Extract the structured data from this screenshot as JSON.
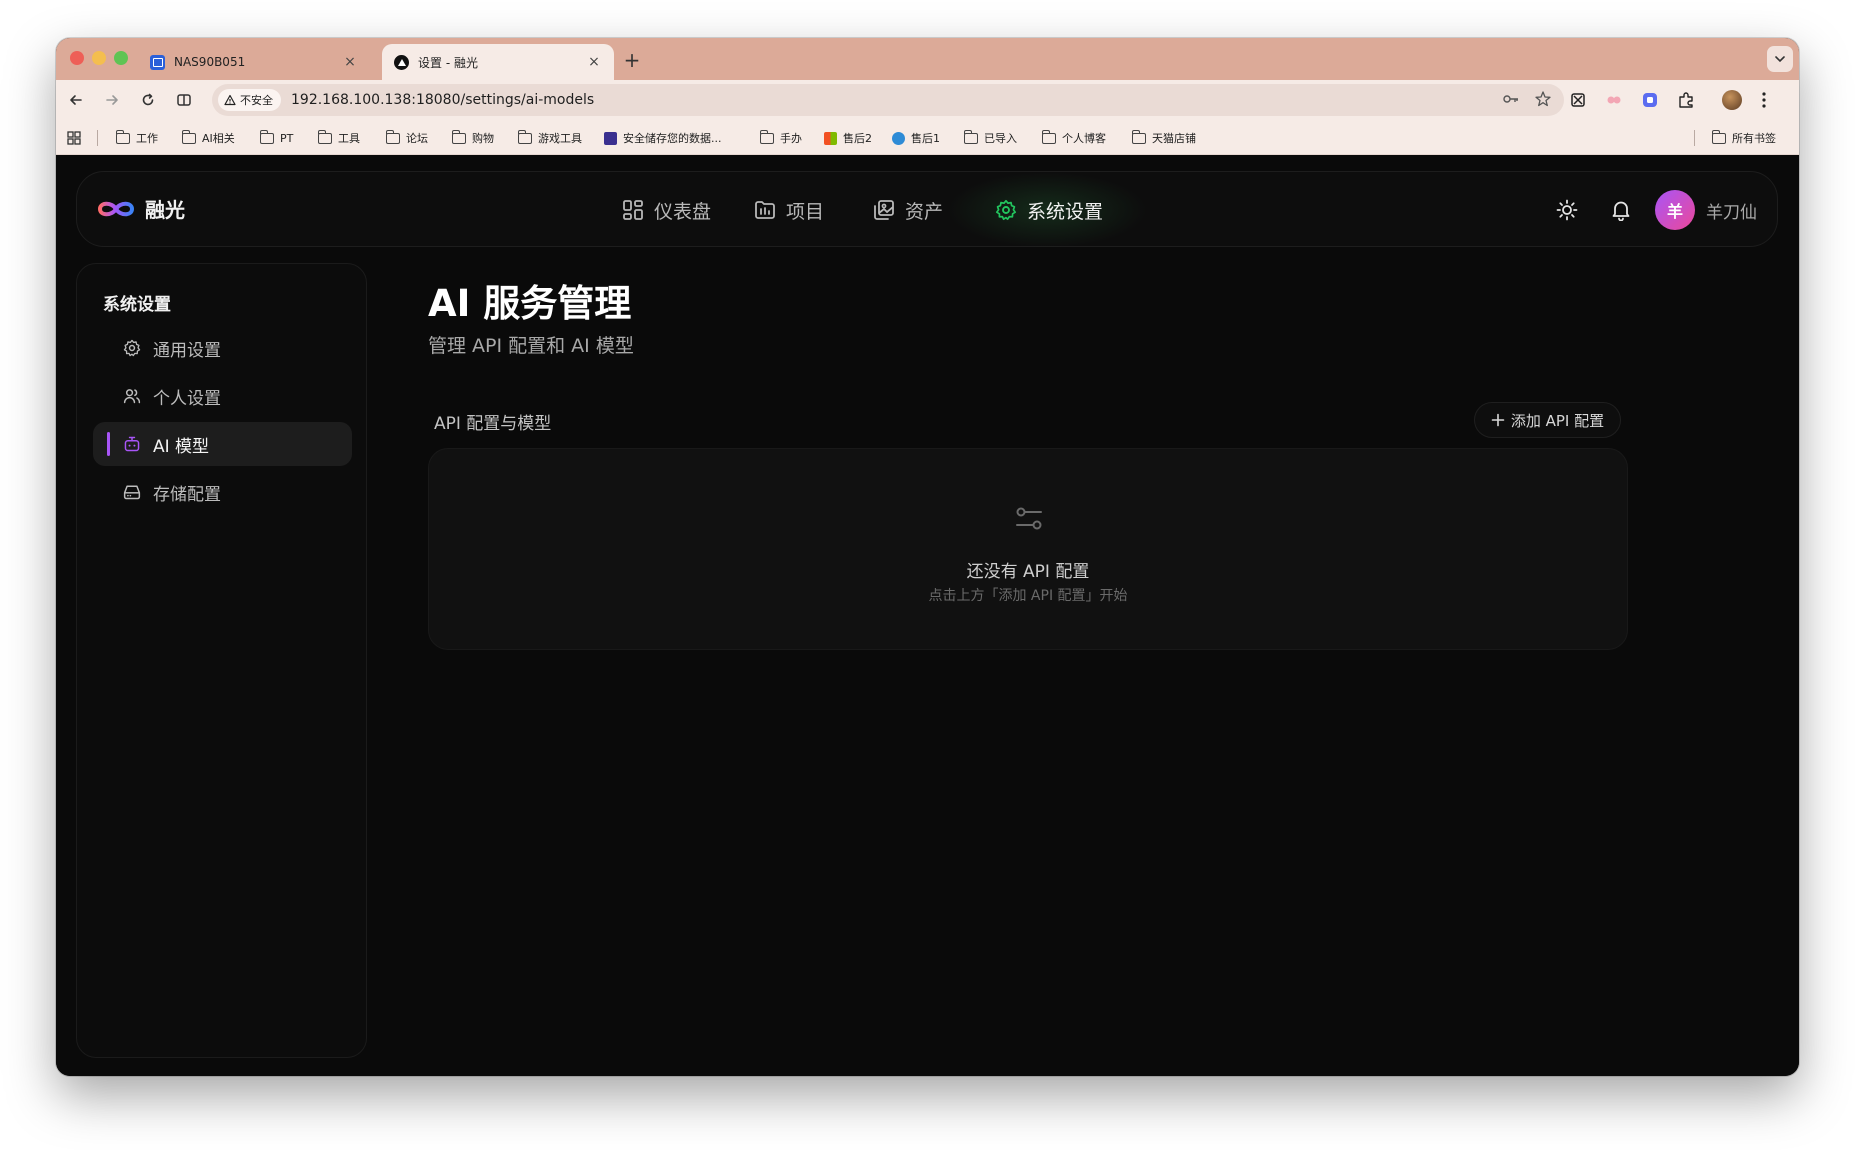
{
  "browser": {
    "tabs": [
      {
        "title": "NAS90B051",
        "close": "×"
      },
      {
        "title": "设置 - 融光",
        "close": "×"
      }
    ],
    "new_tab": "+",
    "security_label": "不安全",
    "url": "192.168.100.138:18080/settings/ai-models",
    "bookmarks": [
      "工作",
      "AI相关",
      "PT",
      "工具",
      "论坛",
      "购物",
      "游戏工具",
      "安全储存您的数据...",
      "手办",
      "售后2",
      "售后1",
      "已导入",
      "个人博客",
      "天猫店铺"
    ],
    "all_bookmarks": "所有书签"
  },
  "app": {
    "logo_text": "融光",
    "nav": [
      {
        "label": "仪表盘",
        "icon": "dashboard-icon"
      },
      {
        "label": "项目",
        "icon": "folder-icon"
      },
      {
        "label": "资产",
        "icon": "images-icon"
      },
      {
        "label": "系统设置",
        "icon": "gear-icon",
        "active": true
      }
    ],
    "user": {
      "avatar_letter": "羊",
      "name": "羊刀仙"
    },
    "accent_color": "#a855f7",
    "active_nav_color": "#22c55e"
  },
  "sidebar": {
    "title": "系统设置",
    "items": [
      {
        "label": "通用设置",
        "icon": "gear-icon"
      },
      {
        "label": "个人设置",
        "icon": "users-icon"
      },
      {
        "label": "AI 模型",
        "icon": "bot-icon",
        "active": true
      },
      {
        "label": "存储配置",
        "icon": "hard-drive-icon"
      }
    ]
  },
  "main": {
    "title": "AI 服务管理",
    "subtitle": "管理 API 配置和 AI 模型",
    "section_title": "API 配置与模型",
    "add_button": "添加 API 配置",
    "empty_title": "还没有 API 配置",
    "empty_hint": "点击上方「添加 API 配置」开始"
  }
}
